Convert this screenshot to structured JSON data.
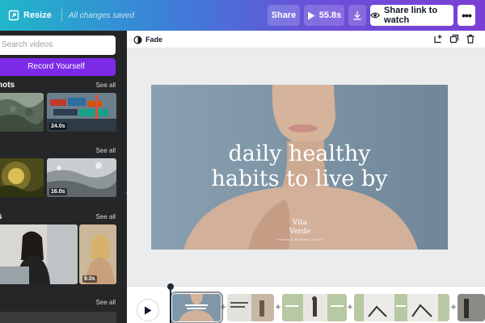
{
  "topbar": {
    "resize_label": "Resize",
    "saved_status": "All changes saved",
    "share_label": "Share",
    "play_duration": "55.8s",
    "share_link_label": "Share link to watch",
    "more_label": "•••"
  },
  "left_panel": {
    "search_placeholder": "Search videos",
    "record_label": "Record Yourself",
    "sections": [
      {
        "title": "hots",
        "see_all": "See all",
        "durations": [
          "",
          "24.0s"
        ]
      },
      {
        "title": "",
        "see_all": "See all",
        "durations": [
          "",
          "16.0s"
        ]
      },
      {
        "title": "s",
        "see_all": "See all",
        "durations": [
          "",
          "9.0s"
        ]
      },
      {
        "title": "",
        "see_all": "See all"
      }
    ]
  },
  "editor": {
    "transition_label": "Fade",
    "slide": {
      "headline_line1": "daily healthy",
      "headline_line2": "habits to live by",
      "brand_line1": "Vita",
      "brand_line2": "Verde",
      "brand_tagline": "Fitness & Wellness Center"
    }
  },
  "colors": {
    "accent_purple": "#7d2ae8",
    "panel_dark": "#252627",
    "canvas_bg": "#ebeced"
  },
  "icons": [
    "resize-icon",
    "play-icon",
    "download-icon",
    "eye-icon",
    "more-icon",
    "fade-icon",
    "add-page-icon",
    "duplicate-icon",
    "trash-icon",
    "chevron-left-icon"
  ]
}
